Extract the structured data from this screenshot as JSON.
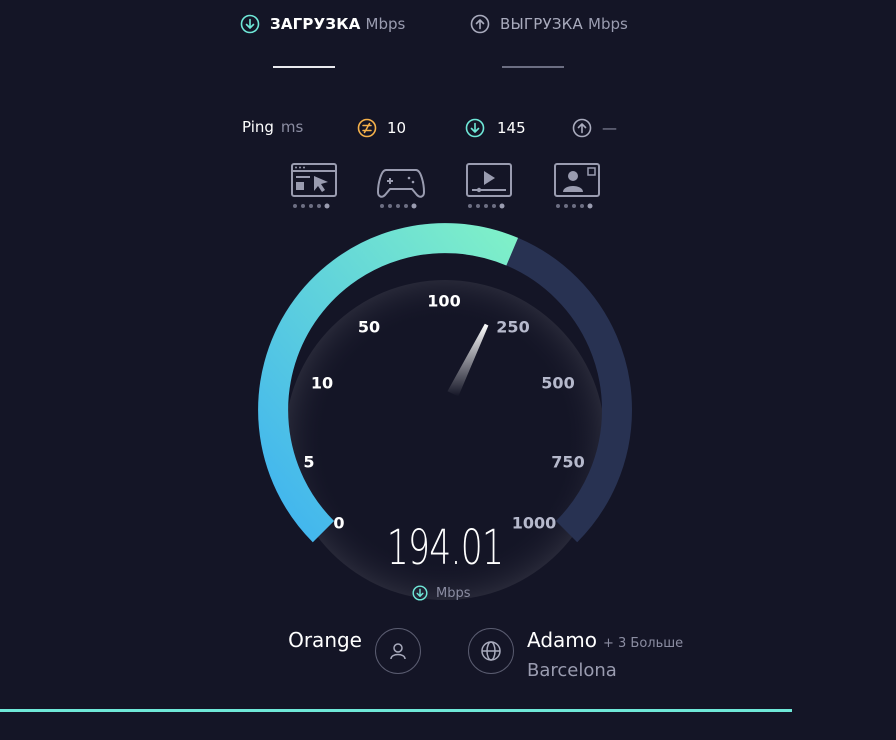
{
  "tabs": [
    {
      "label": "ЗАГРУЗКА",
      "unit": "Mbps",
      "icon": "download-arrow-icon",
      "active": true
    },
    {
      "label": "ВЫГРУЗКА",
      "unit": "Mbps",
      "icon": "upload-arrow-icon",
      "active": false
    }
  ],
  "ping": {
    "label": "Ping",
    "unit": "ms",
    "idle": "10",
    "download": "145",
    "upload": "—"
  },
  "use_cases": [
    {
      "icon": "web-browsing-icon"
    },
    {
      "icon": "gaming-icon"
    },
    {
      "icon": "video-streaming-icon"
    },
    {
      "icon": "video-call-icon"
    }
  ],
  "gauge": {
    "ticks": [
      "0",
      "5",
      "10",
      "50",
      "100",
      "250",
      "500",
      "750",
      "1000"
    ],
    "speed": "194.01",
    "unit": "Mbps",
    "fill_colors": [
      "#3fb3f0",
      "#7ff0c8"
    ],
    "track_color": "#283252"
  },
  "provider": {
    "name": "Orange"
  },
  "server": {
    "name": "Adamo",
    "more": "+ 3 Больше",
    "city": "Barcelona"
  },
  "colors": {
    "accent": "#6fe8d8",
    "bg": "#141526"
  }
}
